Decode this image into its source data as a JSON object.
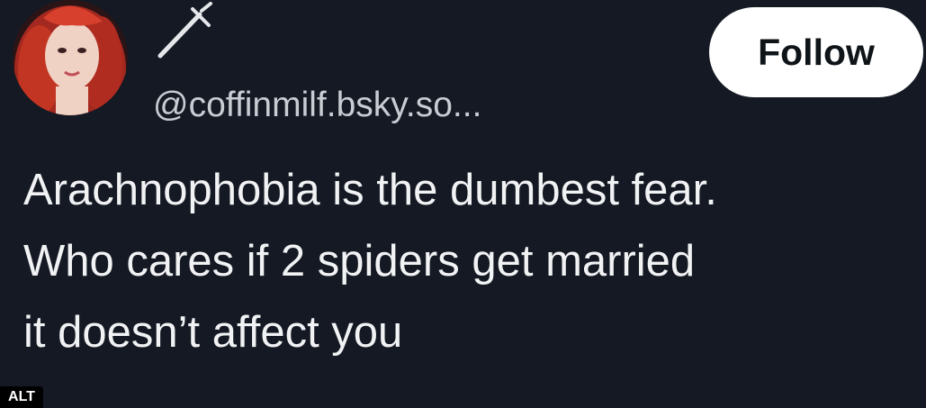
{
  "post": {
    "handle": "@coffinmilf.bsky.so...",
    "follow_label": "Follow",
    "text_lines": [
      "Arachnophobia is the dumbest fear.",
      "Who cares if 2 spiders get married",
      "it doesn’t affect you"
    ],
    "name_icon": "dagger-icon",
    "avatar_icon": "avatar"
  },
  "image_badge": {
    "label": "ALT"
  },
  "colors": {
    "background": "#141923",
    "text": "#f1f2f4",
    "handle_text": "#c9ccd3",
    "follow_bg": "#ffffff",
    "follow_text": "#0f1419"
  }
}
